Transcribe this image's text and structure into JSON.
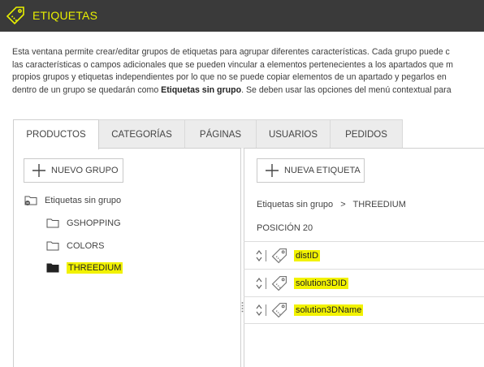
{
  "header": {
    "title": "ETIQUETAS",
    "accent": "#e8f000",
    "background": "#3a3a3a"
  },
  "description": {
    "line1": "Esta ventana permite crear/editar grupos de etiquetas para agrupar diferentes características. Cada grupo puede c",
    "line2": "las características o campos adicionales que se pueden vincular a elementos pertenecientes a los apartados que m",
    "line3": "propios grupos y etiquetas independientes por lo que no se puede copiar elementos de un apartado y pegarlos en",
    "line4_a": "dentro de un grupo se quedarán como ",
    "line4_b": "Etiquetas sin grupo",
    "line4_c": ". Se deben usar las opciones del menú contextual para"
  },
  "tabs": [
    {
      "label": "PRODUCTOS",
      "active": true
    },
    {
      "label": "CATEGORÍAS",
      "active": false
    },
    {
      "label": "PÁGINAS",
      "active": false
    },
    {
      "label": "USUARIOS",
      "active": false
    },
    {
      "label": "PEDIDOS",
      "active": false
    }
  ],
  "left_panel": {
    "new_group_label": "NUEVO GRUPO",
    "tree": {
      "root": "Etiquetas sin grupo",
      "children": [
        "GSHOPPING",
        "COLORS",
        "THREEDIUM"
      ],
      "selected": "THREEDIUM"
    }
  },
  "right_panel": {
    "new_tag_label": "NUEVA ETIQUETA",
    "breadcrumb": {
      "root": "Etiquetas sin grupo",
      "separator": ">",
      "current": "THREEDIUM"
    },
    "position": "POSICIÓN 20",
    "tags": [
      "distID",
      "solution3DID",
      "solution3DName"
    ]
  },
  "highlight_color": "#f2f200"
}
